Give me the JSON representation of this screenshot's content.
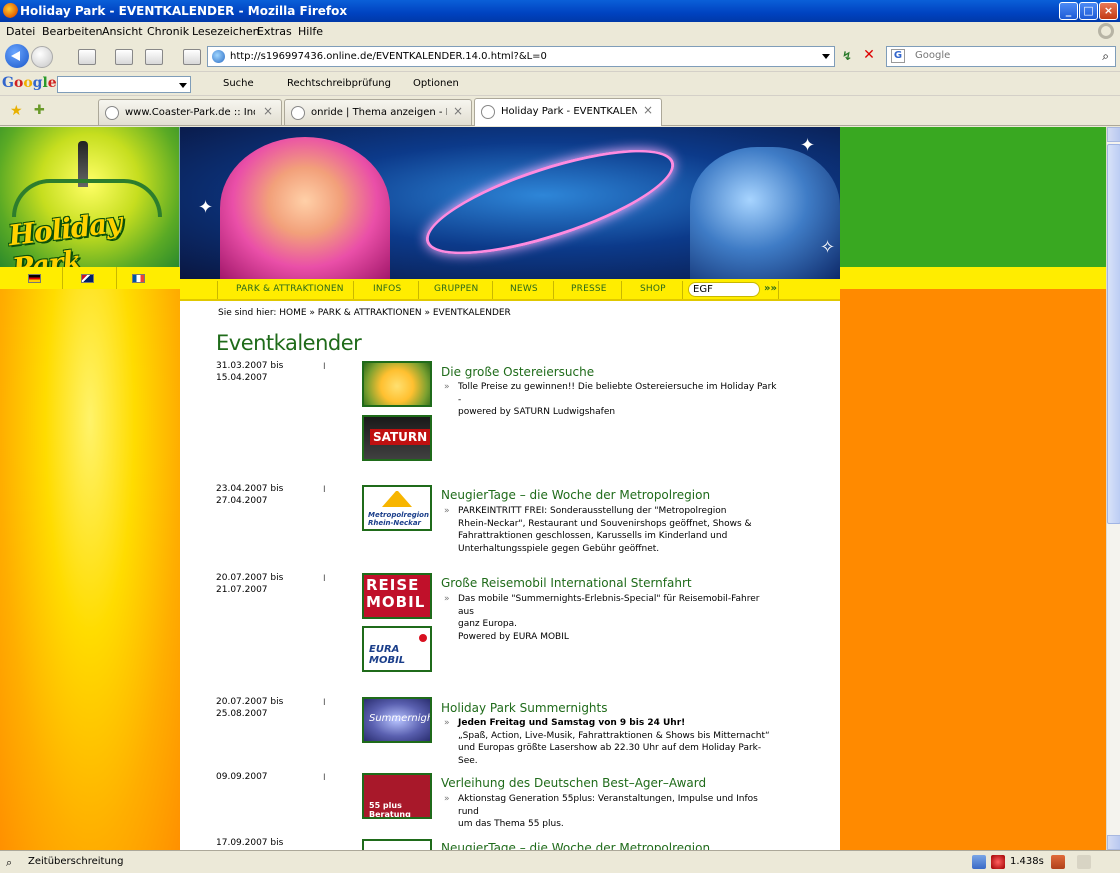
{
  "window": {
    "title": "Holiday Park - EVENTKALENDER - Mozilla Firefox",
    "minimize": "_",
    "maximize": "□",
    "close": "×"
  },
  "menu": [
    "Datei",
    "Bearbeiten",
    "Ansicht",
    "Chronik",
    "Lesezeichen",
    "Extras",
    "Hilfe"
  ],
  "address": {
    "url": "http://s196997436.online.de/EVENTKALENDER.14.0.html?&L=0"
  },
  "search": {
    "placeholder": "Google"
  },
  "google_toolbar": {
    "logo": "Google",
    "search_label": "Suche",
    "spellcheck_label": "Rechtschreibprüfung",
    "options_label": "Optionen"
  },
  "tabs": [
    {
      "label": "www.Coaster-Park.de :: Index"
    },
    {
      "label": "onride | Thema anzeigen - Neu..."
    },
    {
      "label": "Holiday Park - EVENTKALENDER"
    }
  ],
  "site": {
    "logo_text": "Holiday Park",
    "nav": [
      "PARK & ATTRAKTIONEN",
      "INFOS",
      "GRUPPEN",
      "NEWS",
      "PRESSE",
      "SHOP"
    ],
    "search_value": "EGF",
    "search_go": "»»",
    "breadcrumb": "Sie sind hier:  HOME » PARK & ATTRAKTIONEN » EVENTKALENDER",
    "page_title": "Eventkalender",
    "separator": "I",
    "bullet": "»"
  },
  "events": [
    {
      "date_from": "31.03.2007 bis",
      "date_to": "15.04.2007",
      "title": "Die große Ostereiersuche",
      "desc_lines": [
        "Tolle Preise zu gewinnen!! Die beliebte Ostereiersuche im Holiday Park -",
        "powered by SATURN Ludwigshafen"
      ],
      "logos": [
        "",
        "SATURN"
      ]
    },
    {
      "date_from": "23.04.2007 bis",
      "date_to": "27.04.2007",
      "title": "NeugierTage – die Woche der Metropolregion",
      "desc_lines": [
        "PARKEINTRITT FREI: Sonderausstellung der \"Metropolregion",
        "Rhein-Neckar\", Restaurant und Souvenirshops geöffnet, Shows &",
        "Fahrattraktionen geschlossen, Karussells im Kinderland und",
        "Unterhaltungsspiele gegen Gebühr geöffnet."
      ],
      "logos": [
        "Metropolregion Rhein-Neckar"
      ]
    },
    {
      "date_from": "20.07.2007 bis",
      "date_to": "21.07.2007",
      "title": "Große Reisemobil International Sternfahrt",
      "desc_lines": [
        "Das mobile \"Summernights-Erlebnis-Special\" für Reisemobil-Fahrer aus",
        "ganz Europa.",
        "Powered by EURA MOBIL"
      ],
      "logos": [
        "REISE MOBIL",
        "EURA MOBIL"
      ]
    },
    {
      "date_from": "20.07.2007 bis",
      "date_to": "25.08.2007",
      "title": "Holiday Park Summernights",
      "desc_bold": "Jeden Freitag und Samstag von 9 bis 24 Uhr!",
      "desc_lines": [
        "„Spaß, Action, Live-Musik, Fahrattraktionen & Shows bis Mitternacht“",
        "und Europas größte Lasershow  ab 22.30 Uhr auf dem Holiday Park-See."
      ],
      "logos": [
        "Summernights"
      ]
    },
    {
      "date_from": "09.09.2007",
      "date_to": "",
      "title": "Verleihung des Deutschen Best–Ager–Award",
      "desc_lines": [
        "Aktionstag Generation 55plus: Veranstaltungen, Impulse und Infos rund",
        "um das Thema 55 plus."
      ],
      "logos": [
        "55 plus Beratung"
      ]
    },
    {
      "date_from": "17.09.2007 bis",
      "date_to": "",
      "title": "NeugierTage – die Woche der Metropolregion",
      "desc_lines": [],
      "logos": []
    }
  ],
  "status": {
    "text": "Zeitüberschreitung",
    "speed": "1.438s"
  },
  "colors": {
    "site_green": "#1f6b1a",
    "nav_yellow": "#ffed00",
    "bg_orange": "#ff8a00",
    "bg_green": "#39a821"
  }
}
